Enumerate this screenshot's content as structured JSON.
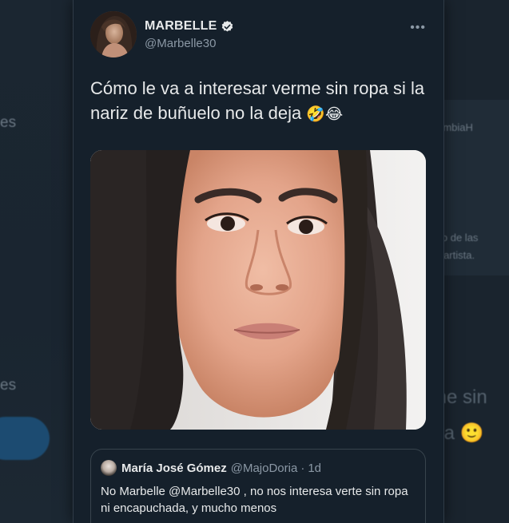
{
  "tweet": {
    "display_name": "MARBELLE",
    "handle": "@Marbelle30",
    "more_label": "•••",
    "text": "Cómo le va a interesar verme sin ropa si la nariz de buñuelo no la deja",
    "text_emojis": "🤣😂",
    "media_alt": "photo of a woman with long dark hair"
  },
  "quoted_tweet": {
    "display_name": "María José Gómez",
    "handle": "@MajoDoria",
    "separator": "·",
    "time": "1d",
    "text": "No Marbelle @Marbelle30 , no nos interesa verte sin ropa ni encapuchada, y mucho menos"
  },
  "background": {
    "left_fragment_1": "es",
    "left_fragment_2": "es",
    "right_fragment_1": "olombiaH",
    "right_fragment_2": "sico de las",
    "right_fragment_3": "na artista.",
    "right_fragment_4": "me sin",
    "right_fragment_5": "eja 🙂"
  },
  "colors": {
    "card_background": "#15202b",
    "primary_text": "#e7e9ea",
    "secondary_text": "#8b98a5",
    "verified_badge": "#e7e9ea",
    "border": "#38444d"
  }
}
